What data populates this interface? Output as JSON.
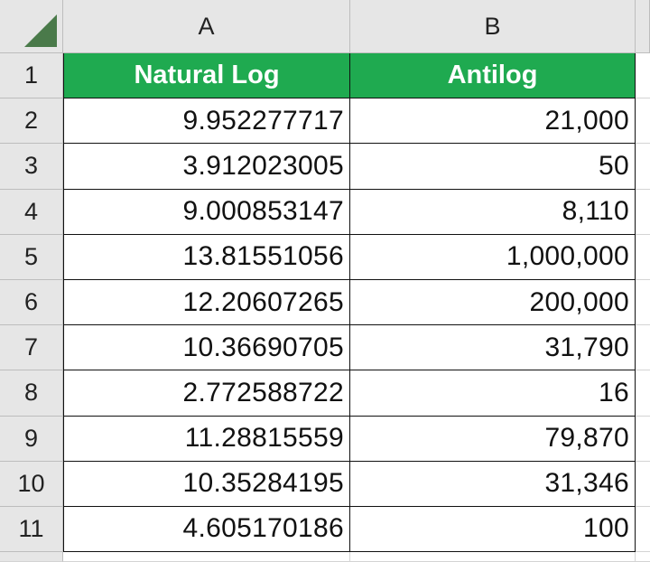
{
  "columns": [
    "A",
    "B"
  ],
  "headers": {
    "col_a": "Natural Log",
    "col_b": "Antilog"
  },
  "header_row_number": "1",
  "rows": [
    {
      "row": "2",
      "natural_log": "9.952277717",
      "antilog": "21,000"
    },
    {
      "row": "3",
      "natural_log": "3.912023005",
      "antilog": "50"
    },
    {
      "row": "4",
      "natural_log": "9.000853147",
      "antilog": "8,110"
    },
    {
      "row": "5",
      "natural_log": "13.81551056",
      "antilog": "1,000,000"
    },
    {
      "row": "6",
      "natural_log": "12.20607265",
      "antilog": "200,000"
    },
    {
      "row": "7",
      "natural_log": "10.36690705",
      "antilog": "31,790"
    },
    {
      "row": "8",
      "natural_log": "2.772588722",
      "antilog": "16"
    },
    {
      "row": "9",
      "natural_log": "11.28815559",
      "antilog": "79,870"
    },
    {
      "row": "10",
      "natural_log": "10.35284195",
      "antilog": "31,346"
    },
    {
      "row": "11",
      "natural_log": "4.605170186",
      "antilog": "100"
    }
  ],
  "colors": {
    "header_fill": "#1faa50",
    "header_text": "#ffffff",
    "gridline": "#d4d4d4",
    "heading_strip": "#e6e6e6",
    "select_all_triangle": "#4a7a4a"
  }
}
